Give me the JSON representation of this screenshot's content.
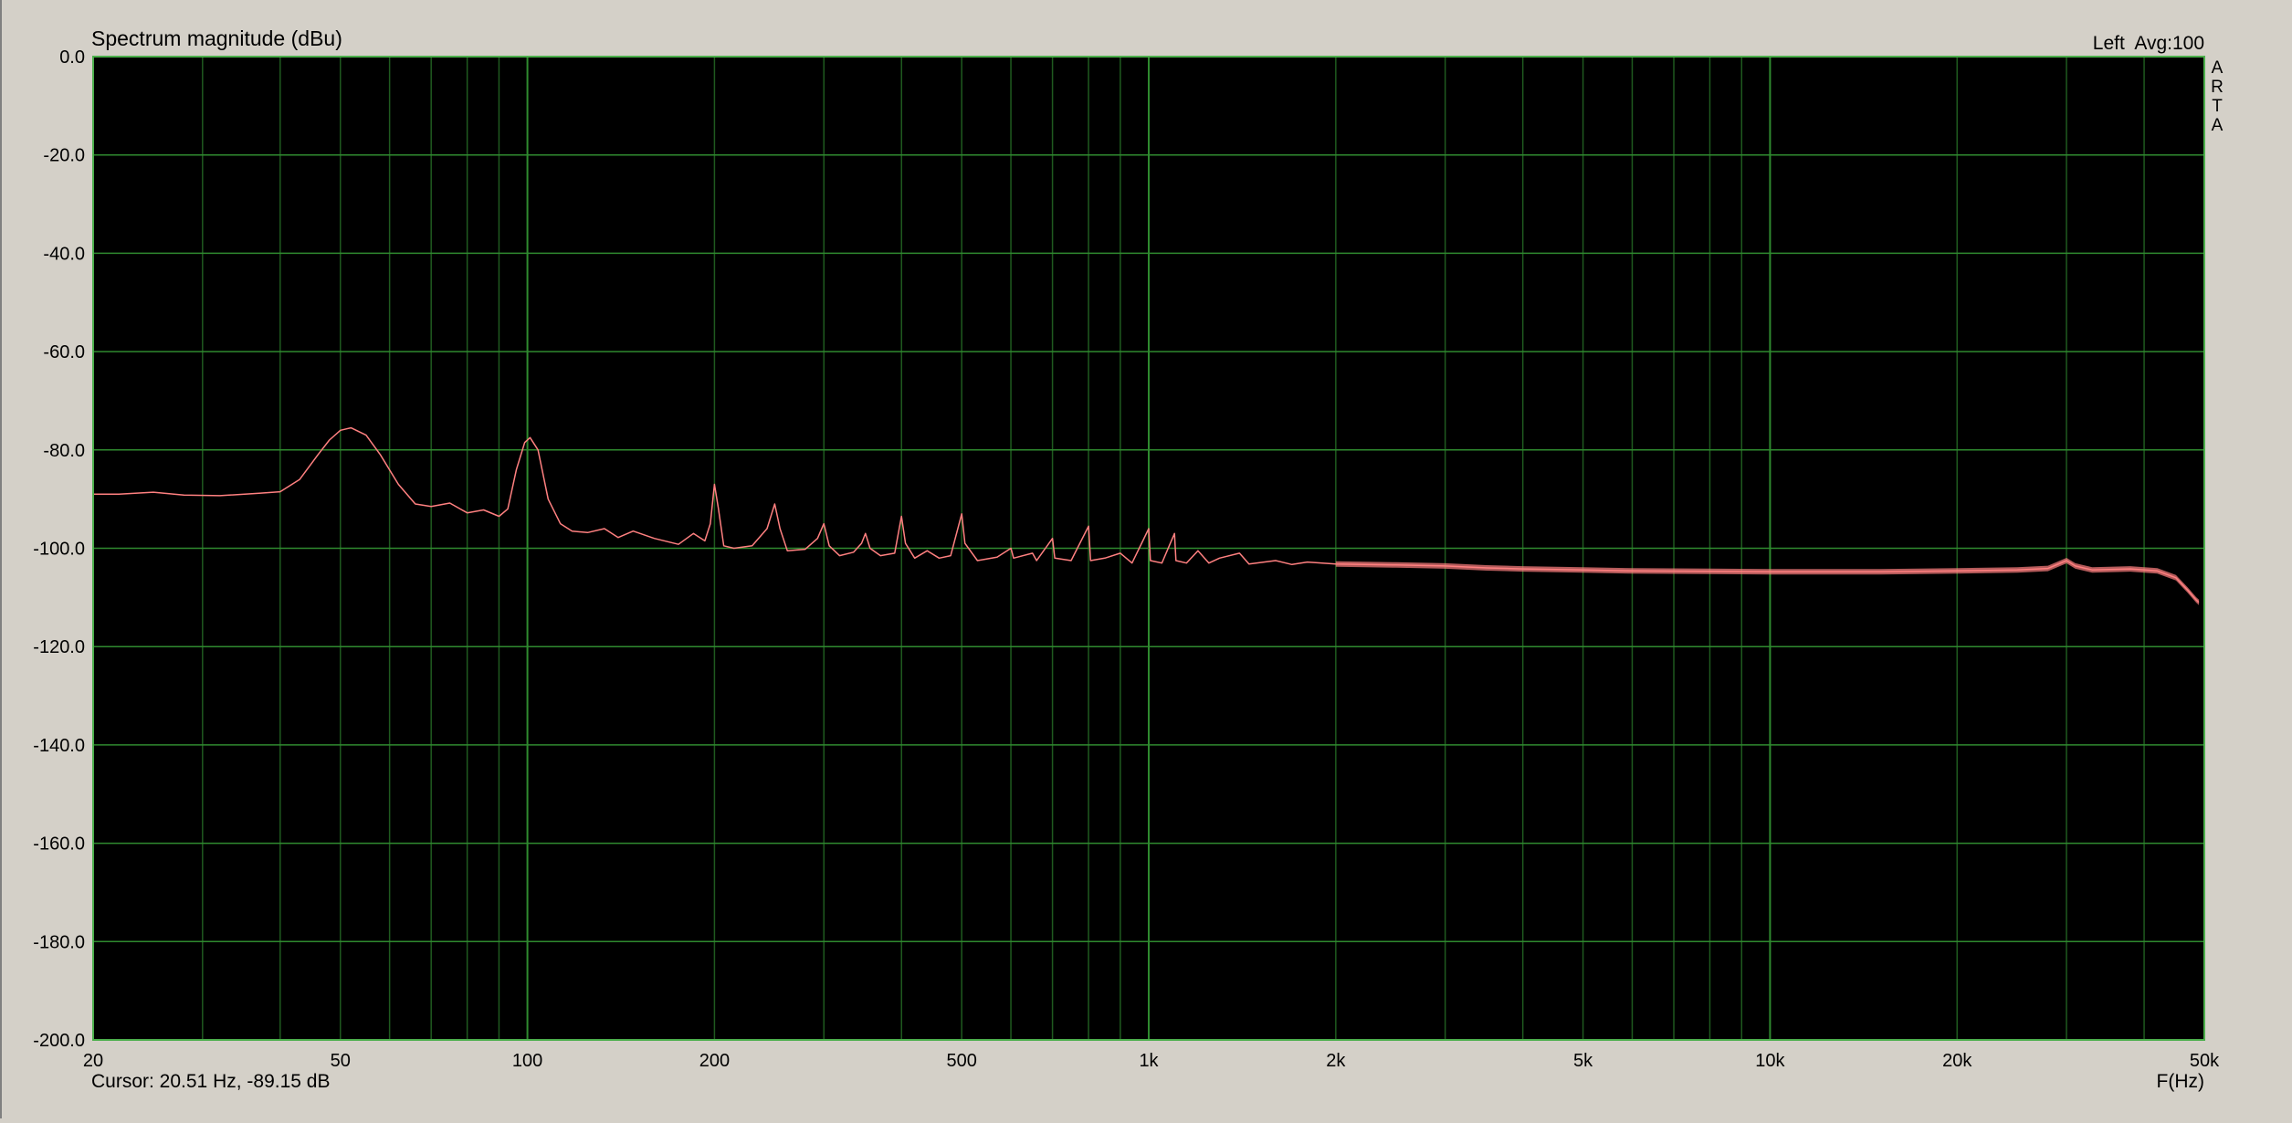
{
  "header": {
    "title": "Spectrum magnitude (dBu)",
    "channel_info": "Left  Avg:100",
    "brand": [
      "A",
      "R",
      "T",
      "A"
    ]
  },
  "footer": {
    "cursor": "Cursor: 20.51 Hz, -89.15 dB",
    "xlabel": "F(Hz)"
  },
  "colors": {
    "plot_bg": "#000000",
    "grid": "#1f5a1f",
    "grid_major": "#2f8a2f",
    "frame": "#4caf4c",
    "trace": "#ff8080",
    "window_bg": "#d4d0c8"
  },
  "chart_data": {
    "type": "line",
    "title": "Spectrum magnitude (dBu)",
    "xlabel": "F(Hz)",
    "ylabel": "",
    "xscale": "log",
    "xlim": [
      20,
      50000
    ],
    "ylim": [
      -200,
      0
    ],
    "grid": true,
    "xticks": [
      20,
      50,
      100,
      200,
      500,
      1000,
      2000,
      5000,
      10000,
      20000,
      50000
    ],
    "xtick_labels": [
      "20",
      "50",
      "100",
      "200",
      "500",
      "1k",
      "2k",
      "5k",
      "10k",
      "20k",
      "50k"
    ],
    "yticks": [
      0,
      -20,
      -40,
      -60,
      -80,
      -100,
      -120,
      -140,
      -160,
      -180,
      -200
    ],
    "ytick_labels": [
      "0.0",
      "-20.0",
      "-40.0",
      "-60.0",
      "-80.0",
      "-100.0",
      "-120.0",
      "-140.0",
      "-160.0",
      "-180.0",
      "-200.0"
    ],
    "series": [
      {
        "points": [
          [
            20,
            -89
          ],
          [
            22,
            -89
          ],
          [
            25,
            -88.6
          ],
          [
            28,
            -89.2
          ],
          [
            32,
            -89.3
          ],
          [
            37,
            -88.8
          ],
          [
            40,
            -88.5
          ],
          [
            43,
            -86
          ],
          [
            46,
            -81
          ],
          [
            48,
            -78
          ],
          [
            50,
            -76
          ],
          [
            52,
            -75.5
          ],
          [
            55,
            -77
          ],
          [
            58,
            -81
          ],
          [
            62,
            -87
          ],
          [
            66,
            -91
          ],
          [
            70,
            -91.5
          ],
          [
            75,
            -90.8
          ],
          [
            80,
            -92.8
          ],
          [
            85,
            -92.2
          ],
          [
            90,
            -93.5
          ],
          [
            93,
            -92
          ],
          [
            96,
            -84
          ],
          [
            99,
            -78.5
          ],
          [
            101,
            -77.5
          ],
          [
            104,
            -80
          ],
          [
            108,
            -90
          ],
          [
            113,
            -95
          ],
          [
            118,
            -96.5
          ],
          [
            125,
            -96.8
          ],
          [
            133,
            -96
          ],
          [
            140,
            -97.8
          ],
          [
            148,
            -96.5
          ],
          [
            160,
            -98
          ],
          [
            175,
            -99.2
          ],
          [
            185,
            -97
          ],
          [
            193,
            -98.5
          ],
          [
            197,
            -95
          ],
          [
            200,
            -87
          ],
          [
            203,
            -92
          ],
          [
            207,
            -99.5
          ],
          [
            215,
            -100
          ],
          [
            230,
            -99.5
          ],
          [
            243,
            -96
          ],
          [
            250,
            -91
          ],
          [
            255,
            -96
          ],
          [
            262,
            -100.5
          ],
          [
            280,
            -100.2
          ],
          [
            293,
            -98
          ],
          [
            300,
            -95
          ],
          [
            306,
            -99.5
          ],
          [
            318,
            -101.5
          ],
          [
            335,
            -100.8
          ],
          [
            345,
            -99
          ],
          [
            350,
            -97
          ],
          [
            356,
            -100
          ],
          [
            370,
            -101.5
          ],
          [
            390,
            -101
          ],
          [
            400,
            -93.5
          ],
          [
            406,
            -99
          ],
          [
            420,
            -102
          ],
          [
            440,
            -100.5
          ],
          [
            460,
            -102
          ],
          [
            480,
            -101.5
          ],
          [
            500,
            -93
          ],
          [
            506,
            -99
          ],
          [
            530,
            -102.5
          ],
          [
            570,
            -101.8
          ],
          [
            600,
            -100
          ],
          [
            606,
            -102
          ],
          [
            650,
            -101
          ],
          [
            660,
            -102.5
          ],
          [
            700,
            -98
          ],
          [
            706,
            -102
          ],
          [
            750,
            -102.5
          ],
          [
            800,
            -95.5
          ],
          [
            806,
            -102.5
          ],
          [
            850,
            -102
          ],
          [
            900,
            -101
          ],
          [
            940,
            -103
          ],
          [
            1000,
            -96
          ],
          [
            1006,
            -102.5
          ],
          [
            1050,
            -103
          ],
          [
            1100,
            -97
          ],
          [
            1106,
            -102.5
          ],
          [
            1150,
            -103
          ],
          [
            1200,
            -100.5
          ],
          [
            1250,
            -103
          ],
          [
            1300,
            -102
          ],
          [
            1400,
            -101
          ],
          [
            1450,
            -103.2
          ],
          [
            1600,
            -102.5
          ],
          [
            1700,
            -103.3
          ],
          [
            1800,
            -102.8
          ],
          [
            2000,
            -103.2
          ],
          [
            2500,
            -103.4
          ],
          [
            3000,
            -103.6
          ],
          [
            3500,
            -104
          ],
          [
            4000,
            -104.2
          ],
          [
            5000,
            -104.4
          ],
          [
            6000,
            -104.6
          ],
          [
            8000,
            -104.7
          ],
          [
            10000,
            -104.8
          ],
          [
            12000,
            -104.8
          ],
          [
            15000,
            -104.8
          ],
          [
            20000,
            -104.6
          ],
          [
            25000,
            -104.4
          ],
          [
            28000,
            -104.1
          ],
          [
            30000,
            -102.5
          ],
          [
            31000,
            -103.6
          ],
          [
            33000,
            -104.4
          ],
          [
            38000,
            -104.2
          ],
          [
            42000,
            -104.6
          ],
          [
            45000,
            -106
          ],
          [
            47000,
            -108.5
          ],
          [
            48500,
            -110.5
          ],
          [
            49000,
            -111
          ]
        ]
      }
    ]
  }
}
